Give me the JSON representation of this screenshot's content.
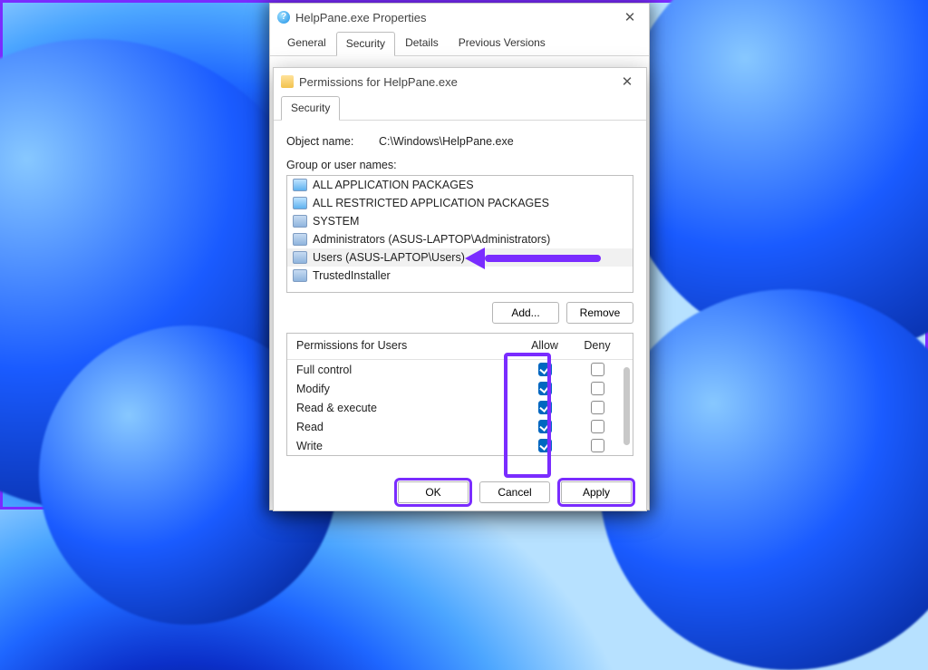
{
  "propsDialog": {
    "title": "HelpPane.exe Properties",
    "tabs": [
      "General",
      "Security",
      "Details",
      "Previous Versions"
    ],
    "activeTab": 1
  },
  "permsDialog": {
    "title": "Permissions for HelpPane.exe",
    "tab": "Security",
    "objectNameLabel": "Object name:",
    "objectName": "C:\\Windows\\HelpPane.exe",
    "groupLabel": "Group or user names:",
    "groups": [
      {
        "label": "ALL APPLICATION PACKAGES",
        "icon": "box"
      },
      {
        "label": "ALL RESTRICTED APPLICATION PACKAGES",
        "icon": "box"
      },
      {
        "label": "SYSTEM",
        "icon": "group"
      },
      {
        "label": "Administrators (ASUS-LAPTOP\\Administrators)",
        "icon": "group"
      },
      {
        "label": "Users (ASUS-LAPTOP\\Users)",
        "icon": "group",
        "selected": true
      },
      {
        "label": "TrustedInstaller",
        "icon": "group"
      }
    ],
    "addLabel": "Add...",
    "removeLabel": "Remove",
    "permsForLabel": "Permissions for Users",
    "colAllow": "Allow",
    "colDeny": "Deny",
    "permissions": [
      {
        "name": "Full control",
        "allow": true,
        "deny": false
      },
      {
        "name": "Modify",
        "allow": true,
        "deny": false
      },
      {
        "name": "Read & execute",
        "allow": true,
        "deny": false
      },
      {
        "name": "Read",
        "allow": true,
        "deny": false
      },
      {
        "name": "Write",
        "allow": true,
        "deny": false
      }
    ],
    "buttons": {
      "ok": "OK",
      "cancel": "Cancel",
      "apply": "Apply"
    }
  }
}
